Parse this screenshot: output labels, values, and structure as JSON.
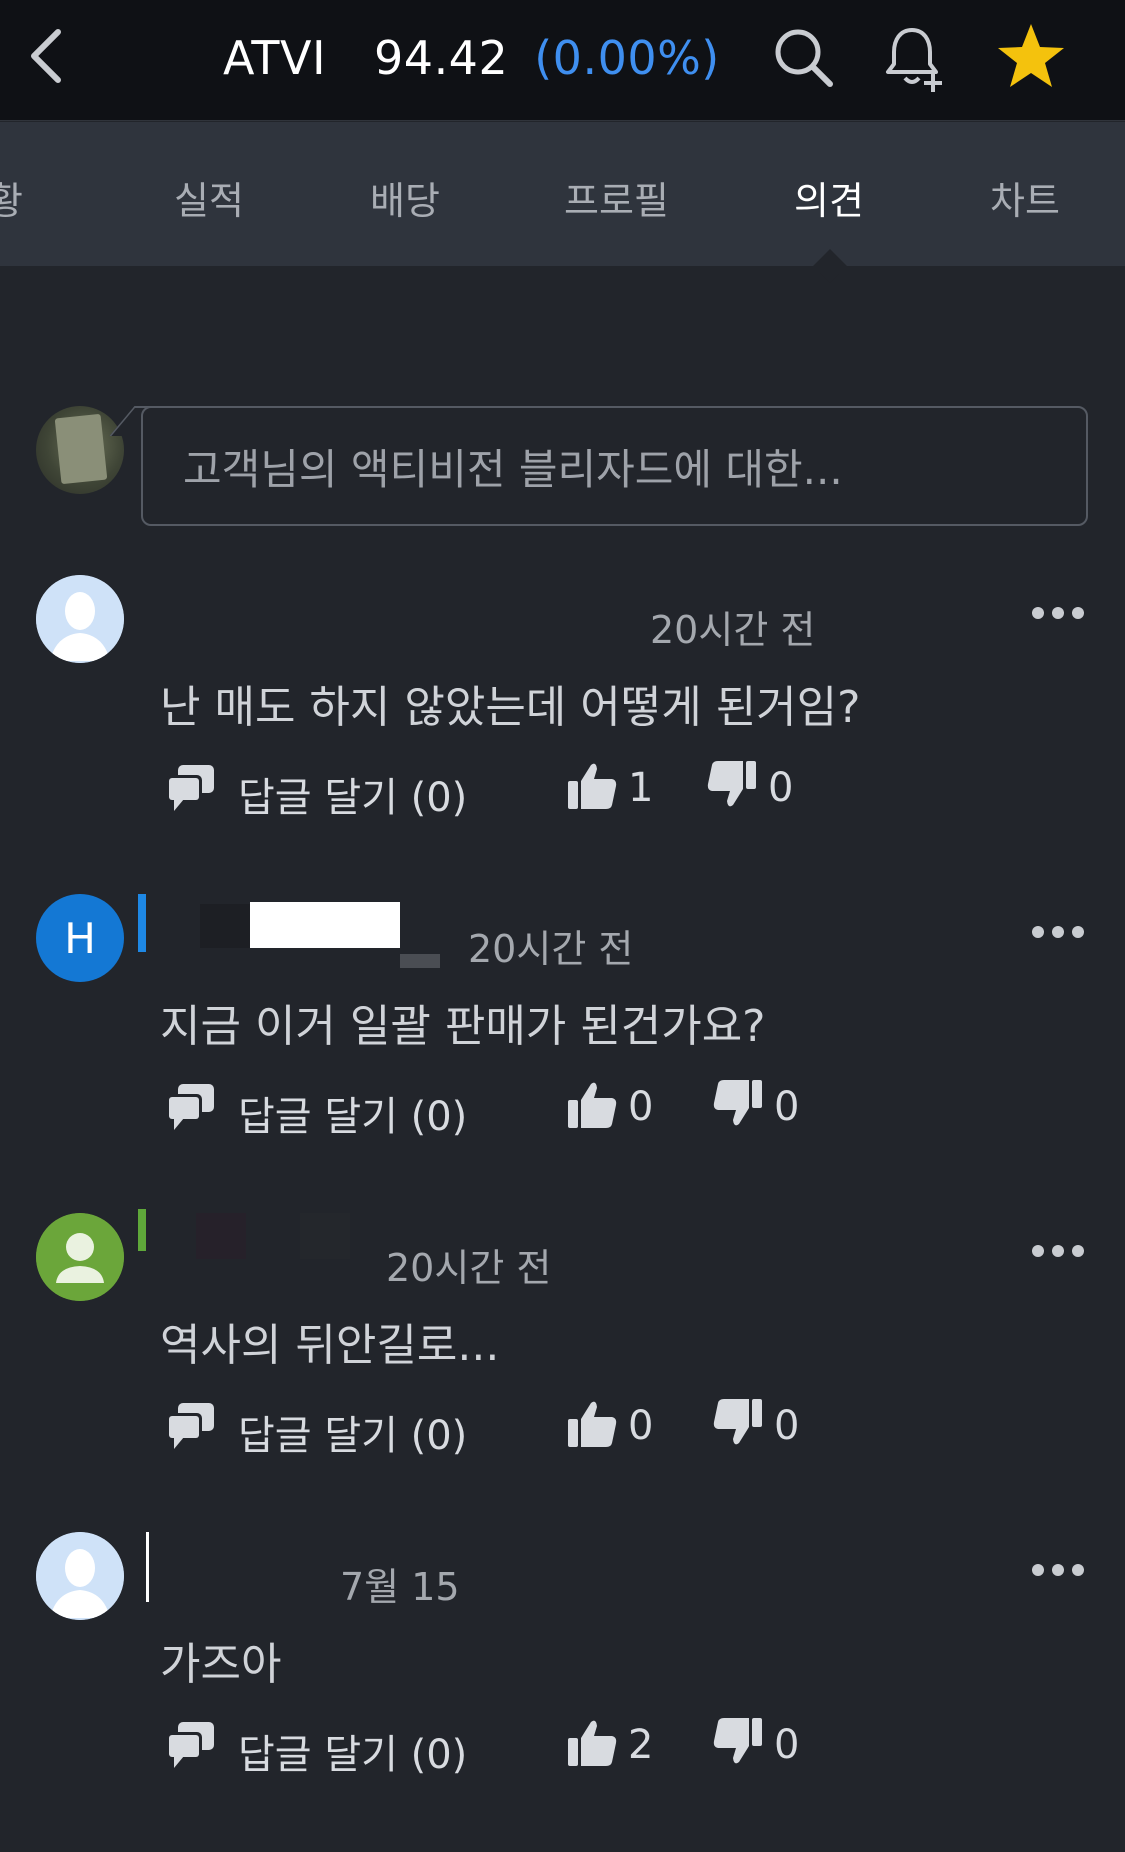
{
  "header": {
    "ticker": "ATVI",
    "price": "94.42",
    "change": "(0.00%)",
    "colors": {
      "change": "#3f8ff0",
      "star": "#f4c20d"
    }
  },
  "tabs": [
    "황",
    "실적",
    "배당",
    "프로필",
    "의견",
    "차트"
  ],
  "tabs_full": {
    "partial_label": "황",
    "active": "의견"
  },
  "composer": {
    "placeholder": "고객님의 액티비전 블리자드에 대한..."
  },
  "comments": [
    {
      "time": "20시간 전",
      "text": "난 매도 하지 않았는데 어떻게 된거임?",
      "reply_label": "답글 달기 (0)",
      "likes": "1",
      "dislikes": "0"
    },
    {
      "avatar_letter": "H",
      "time": "20시간 전",
      "text": "지금 이거 일괄 판매가 된건가요?",
      "reply_label": "답글 달기 (0)",
      "likes": "0",
      "dislikes": "0"
    },
    {
      "time": "20시간 전",
      "text": "역사의 뒤안길로...",
      "reply_label": "답글 달기 (0)",
      "likes": "0",
      "dislikes": "0"
    },
    {
      "time": "7월 15",
      "text": "가즈아",
      "reply_label": "답글 달기 (0)",
      "likes": "2",
      "dislikes": "0"
    }
  ],
  "icons": [
    "chevron-left-icon",
    "search-icon",
    "bell-plus-icon",
    "star-icon",
    "more-dots-icon",
    "reply-icon",
    "thumbs-up-icon",
    "thumbs-down-icon"
  ]
}
